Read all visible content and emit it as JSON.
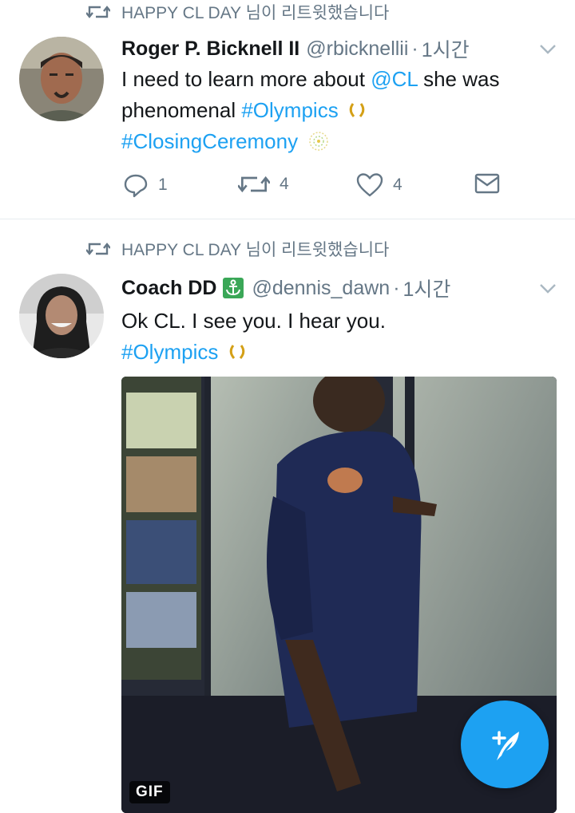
{
  "tweets": [
    {
      "retweeted_by": "HAPPY CL DAY 님이 리트윗했습니다",
      "name": "Roger P. Bicknell II",
      "handle": "@rbicknellii",
      "separator": "·",
      "time": "1시간",
      "text": {
        "l1_a": "I need to learn more about ",
        "l1_mention": "@CL",
        "l1_b": " she was",
        "l2_a": "phenomenal ",
        "l2_tag": "#Olympics",
        "l3_tag": "#ClosingCeremony"
      },
      "reply_count": "1",
      "retweet_count": "4",
      "like_count": "4"
    },
    {
      "retweeted_by": "HAPPY CL DAY 님이 리트윗했습니다",
      "name": "Coach DD",
      "handle": "@dennis_dawn",
      "separator": "·",
      "time": "1시간",
      "text": {
        "l1": "Ok CL. I see you. I hear you.",
        "l2_tag": "#Olympics"
      },
      "media_badge": "GIF"
    }
  ],
  "icons": {
    "retweet": "retweet-icon",
    "chevron": "chevron-down-icon",
    "reply": "reply-icon",
    "like": "heart-icon",
    "dm": "envelope-icon",
    "anchor": "anchor-emoji-icon",
    "laurel": "laurel-emoji-icon",
    "fireworks": "fireworks-emoji-icon",
    "compose": "compose-feather-icon"
  },
  "colors": {
    "link": "#1da1f2",
    "secondary": "#657786",
    "fab": "#1da1f2"
  }
}
